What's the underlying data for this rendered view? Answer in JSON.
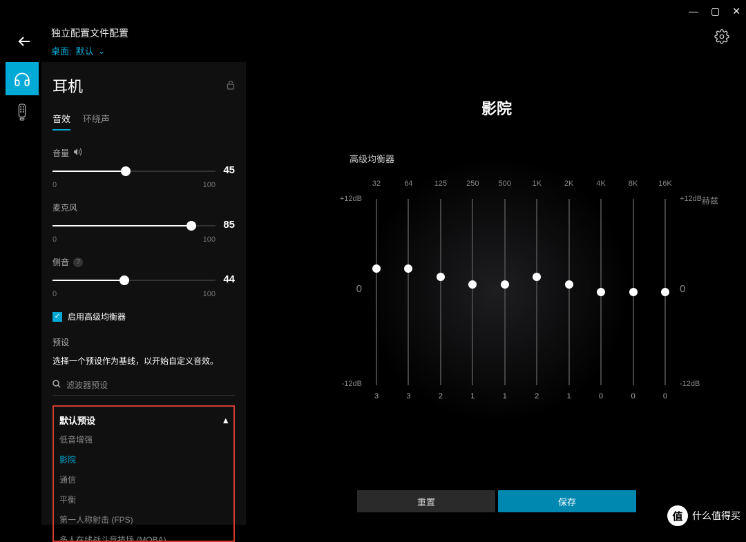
{
  "window": {
    "minimize": "—",
    "maximize": "▢",
    "close": "✕"
  },
  "header": {
    "title": "独立配置文件配置",
    "desktop_prefix": "桌面:",
    "desktop_value": "默认"
  },
  "icons": {
    "back": "←",
    "gear": "⚙",
    "lock": "🔒",
    "chevron_down": "⌄",
    "chevron_up": "▴",
    "volume": "🔊",
    "help": "?",
    "search": "🔍",
    "check": "✓"
  },
  "rail": {
    "items": [
      "headphones",
      "mic"
    ]
  },
  "sidebar": {
    "title": "耳机",
    "tabs": {
      "effects": "音效",
      "surround": "环绕声"
    },
    "sliders": {
      "volume": {
        "label": "音量",
        "min": "0",
        "max": "100",
        "value": 45
      },
      "mic": {
        "label": "麦克风",
        "min": "0",
        "max": "100",
        "value": 85
      },
      "sidetone": {
        "label": "侧音",
        "min": "0",
        "max": "100",
        "value": 44
      }
    },
    "eq_checkbox": "启用高级均衡器",
    "preset_label": "预设",
    "preset_hint": "选择一个预设作为基线，以开始自定义音效。",
    "search_placeholder": "滤波器预设",
    "preset_box": {
      "header": "默认预设",
      "items": [
        "低音增强",
        "影院",
        "通信",
        "平衡",
        "第一人称射击 (FPS)",
        "多人在线战斗竞技场 (MOBA)"
      ],
      "selected_index": 1
    }
  },
  "main": {
    "title": "影院",
    "eq_label": "高级均衡器",
    "hz_label": "赫兹",
    "db_top": "+12dB",
    "db_mid": "0",
    "db_bot": "-12dB",
    "buttons": {
      "reset": "重置",
      "save": "保存"
    }
  },
  "chart_data": {
    "type": "bar",
    "title": "高级均衡器",
    "xlabel": "赫兹",
    "ylabel": "dB",
    "ylim": [
      -12,
      12
    ],
    "categories": [
      "32",
      "64",
      "125",
      "250",
      "500",
      "1K",
      "2K",
      "4K",
      "8K",
      "16K"
    ],
    "values": [
      3,
      3,
      2,
      1,
      1,
      2,
      1,
      0,
      0,
      0
    ]
  },
  "watermark": {
    "badge": "值",
    "text": "什么值得买"
  }
}
